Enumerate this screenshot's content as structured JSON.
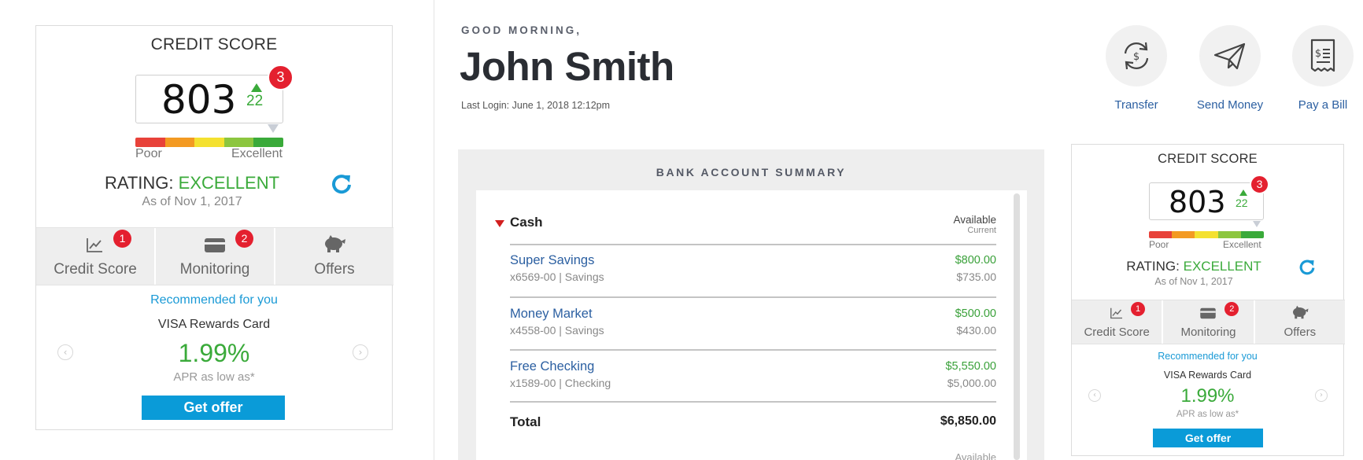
{
  "credit_widget": {
    "title": "CREDIT SCORE",
    "score": "803",
    "change": "22",
    "notification_count": "3",
    "scale_labels": {
      "low": "Poor",
      "high": "Excellent"
    },
    "scale_colors": [
      "#e8423a",
      "#f39a22",
      "#f4e130",
      "#8cc63f",
      "#3aaa3a"
    ],
    "rating_label": "RATING:",
    "rating_value": "EXCELLENT",
    "as_of": "As of Nov 1, 2017",
    "tabs": [
      {
        "label": "Credit Score",
        "icon": "chart-icon",
        "badge": "1"
      },
      {
        "label": "Monitoring",
        "icon": "card-icon",
        "badge": "2"
      },
      {
        "label": "Offers",
        "icon": "piggy-bank-icon",
        "badge": ""
      }
    ],
    "recommended": "Recommended for you",
    "card_name": "VISA Rewards Card",
    "apr": "1.99%",
    "apr_note": "APR as low as*",
    "cta": "Get offer"
  },
  "dashboard": {
    "greeting": "GOOD MORNING,",
    "user_name": "John Smith",
    "last_login": "Last Login: June 1, 2018 12:12pm",
    "actions": [
      {
        "label": "Transfer",
        "icon": "transfer-icon"
      },
      {
        "label": "Send Money",
        "icon": "paper-plane-icon"
      },
      {
        "label": "Pay a Bill",
        "icon": "bill-icon"
      }
    ],
    "summary": {
      "title": "BANK ACCOUNT SUMMARY",
      "section": "Cash",
      "col_available": "Available",
      "col_current": "Current",
      "accounts": [
        {
          "name": "Super Savings",
          "number": "x6569-00 | Savings",
          "available": "$800.00",
          "current": "$735.00"
        },
        {
          "name": "Money Market",
          "number": "x4558-00 | Savings",
          "available": "$500.00",
          "current": "$430.00"
        },
        {
          "name": "Free Checking",
          "number": "x1589-00 | Checking",
          "available": "$5,550.00",
          "current": "$5,000.00"
        }
      ],
      "total_label": "Total",
      "total_value": "$6,850.00",
      "next_available": "Available"
    }
  }
}
